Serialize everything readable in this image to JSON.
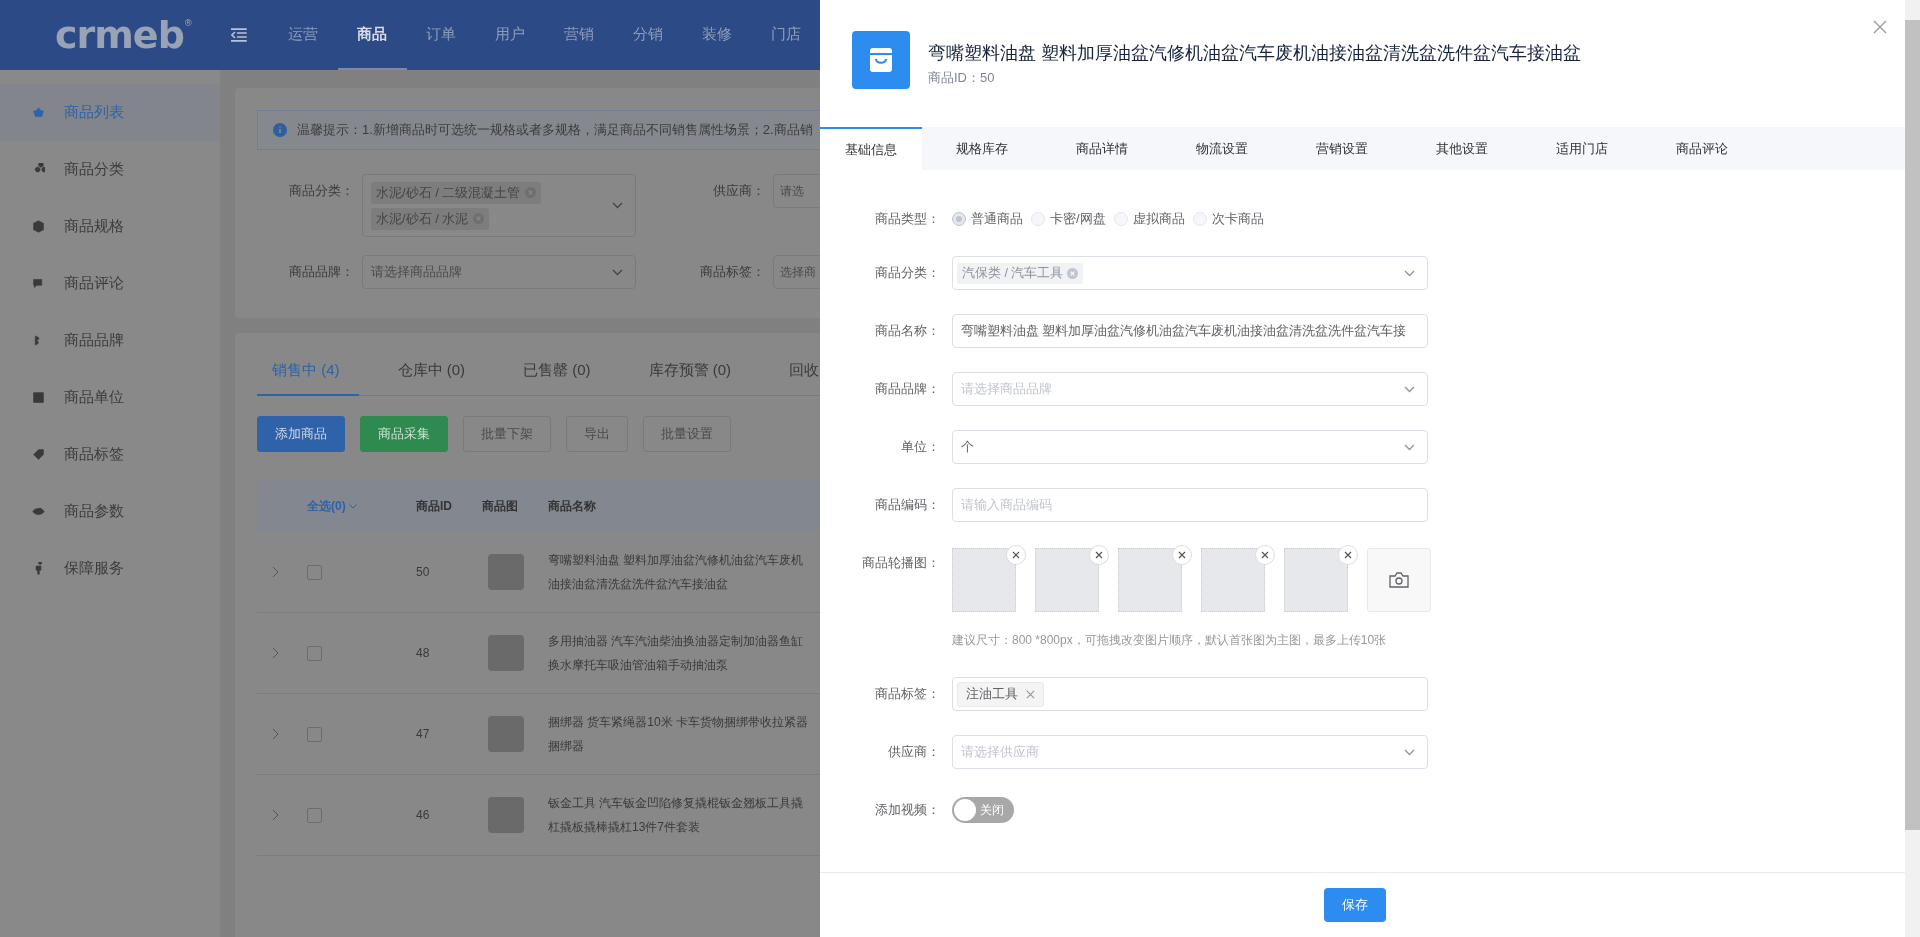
{
  "logo": {
    "text": "crmeb",
    "mark": "®"
  },
  "top_nav": [
    {
      "label": "运营",
      "selected": false
    },
    {
      "label": "商品",
      "selected": true
    },
    {
      "label": "订单",
      "selected": false
    },
    {
      "label": "用户",
      "selected": false
    },
    {
      "label": "营销",
      "selected": false
    },
    {
      "label": "分销",
      "selected": false
    },
    {
      "label": "装修",
      "selected": false
    },
    {
      "label": "门店",
      "selected": false
    }
  ],
  "sidebar": {
    "items": [
      {
        "label": "商品列表",
        "selected": true
      },
      {
        "label": "商品分类",
        "selected": false
      },
      {
        "label": "商品规格",
        "selected": false
      },
      {
        "label": "商品评论",
        "selected": false
      },
      {
        "label": "商品品牌",
        "selected": false
      },
      {
        "label": "商品单位",
        "selected": false
      },
      {
        "label": "商品标签",
        "selected": false
      },
      {
        "label": "商品参数",
        "selected": false
      },
      {
        "label": "保障服务",
        "selected": false
      }
    ]
  },
  "notice": "温馨提示：1.新增商品时可选统一规格或者多规格，满足商品不同销售属性场景；2.商品销",
  "filters": [
    {
      "kind": "tags",
      "label": "商品分类：",
      "tags": [
        "水泥/砂石 / 二级混凝土管",
        "水泥/砂石 / 水泥"
      ]
    },
    {
      "kind": "input",
      "label": "供应商：",
      "placeholder": "请选"
    },
    {
      "kind": "select",
      "label": "商品品牌：",
      "placeholder": "请选择商品品牌"
    },
    {
      "kind": "input",
      "label": "商品标签：",
      "placeholder": "选择商"
    }
  ],
  "status_tabs": [
    {
      "label": "销售中 (4)",
      "selected": true
    },
    {
      "label": "仓库中 (0)",
      "selected": false
    },
    {
      "label": "已售罄 (0)",
      "selected": false
    },
    {
      "label": "库存预警 (0)",
      "selected": false
    },
    {
      "label": "回收",
      "selected": false
    }
  ],
  "actions": [
    {
      "label": "添加商品",
      "kind": "primary"
    },
    {
      "label": "商品采集",
      "kind": "success"
    },
    {
      "label": "批量下架",
      "kind": "disabled"
    },
    {
      "label": "导出",
      "kind": "disabled"
    },
    {
      "label": "批量设置",
      "kind": "disabled"
    }
  ],
  "table": {
    "select_all": "全选(0)",
    "columns": [
      "商品ID",
      "商品图",
      "商品名称"
    ],
    "rows": [
      {
        "id": "50",
        "name": "弯嘴塑料油盘 塑料加厚油盆汽修机油盆汽车废机油接油盆清洗盆洗件盆汽车接油盆",
        "checked": false
      },
      {
        "id": "48",
        "name": "多用抽油器 汽车汽油柴油换油器定制加油器鱼缸换水摩托车吸油管油箱手动抽油泵",
        "checked": false
      },
      {
        "id": "47",
        "name": "捆绑器 货车紧绳器10米 卡车货物捆绑带收拉紧器捆绑器",
        "checked": false
      },
      {
        "id": "46",
        "name": "钣金工具 汽车钣金凹陷修复撬棍钣金翘板工具撬杠撬板撬棒撬杠13件7件套装",
        "checked": false
      }
    ]
  },
  "drawer": {
    "title": "弯嘴塑料油盘 塑料加厚油盆汽修机油盆汽车废机油接油盆清洗盆洗件盆汽车接油盆",
    "subtitle": "商品ID：50",
    "tabs": [
      {
        "label": "基础信息",
        "selected": true
      },
      {
        "label": "规格库存",
        "selected": false
      },
      {
        "label": "商品详情",
        "selected": false
      },
      {
        "label": "物流设置",
        "selected": false
      },
      {
        "label": "营销设置",
        "selected": false
      },
      {
        "label": "其他设置",
        "selected": false
      },
      {
        "label": "适用门店",
        "selected": false
      },
      {
        "label": "商品评论",
        "selected": false
      }
    ],
    "form": [
      {
        "kind": "radio",
        "label": "商品类型：",
        "disabled": true,
        "options": [
          {
            "label": "普通商品",
            "selected": true
          },
          {
            "label": "卡密/网盘",
            "selected": false
          },
          {
            "label": "虚拟商品",
            "selected": false
          },
          {
            "label": "次卡商品",
            "selected": false
          }
        ]
      },
      {
        "kind": "tags",
        "label": "商品分类：",
        "dropdown": true,
        "tags": [
          "汽保类 / 汽车工具"
        ]
      },
      {
        "kind": "input",
        "label": "商品名称：",
        "value": "弯嘴塑料油盘 塑料加厚油盆汽修机油盆汽车废机油接油盆清洗盆洗件盆汽车接"
      },
      {
        "kind": "select",
        "label": "商品品牌：",
        "placeholder": "请选择商品品牌"
      },
      {
        "kind": "select",
        "label": "单位：",
        "value": "个"
      },
      {
        "kind": "input",
        "label": "商品编码：",
        "placeholder": "请输入商品编码"
      },
      {
        "kind": "images",
        "label": "商品轮播图：",
        "images": [
          {
            "removable": true
          },
          {
            "removable": true
          },
          {
            "removable": true
          },
          {
            "removable": true
          },
          {
            "removable": true
          }
        ],
        "hint": "建议尺寸：800 *800px，可拖拽改变图片顺序，默认首张图为主图，最多上传10张"
      },
      {
        "kind": "tags",
        "label": "商品标签：",
        "dropdown": false,
        "tags": [
          "注油工具"
        ]
      },
      {
        "kind": "select",
        "label": "供应商：",
        "placeholder": "请选择供应商"
      },
      {
        "kind": "switch",
        "label": "添加视频：",
        "on": false,
        "text": "关闭"
      }
    ],
    "save": "保存"
  }
}
